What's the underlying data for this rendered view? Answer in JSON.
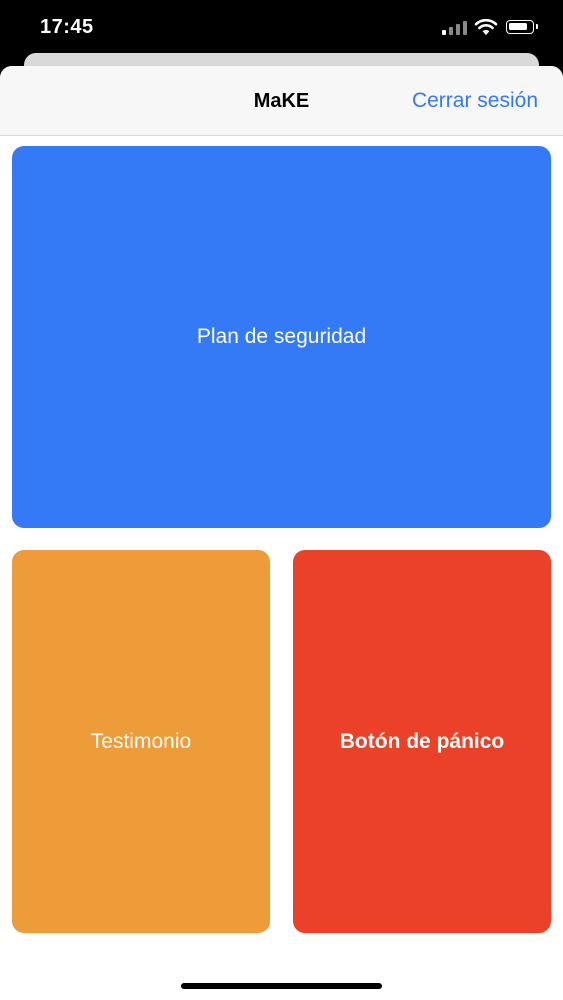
{
  "status_bar": {
    "time": "17:45",
    "icons": [
      "cellular-signal-icon",
      "wifi-icon",
      "battery-icon"
    ]
  },
  "nav": {
    "title": "MaKE",
    "logout_label": "Cerrar sesión"
  },
  "tiles": {
    "security_plan": {
      "label": "Plan de seguridad",
      "color": "#3479f5"
    },
    "testimony": {
      "label": "Testimonio",
      "color": "#ed9c39"
    },
    "panic_button": {
      "label": "Botón de pánico",
      "color": "#ea4128"
    }
  },
  "colors": {
    "accent": "#3478f6",
    "nav_background": "#f7f7f7",
    "status_background": "#000000"
  }
}
